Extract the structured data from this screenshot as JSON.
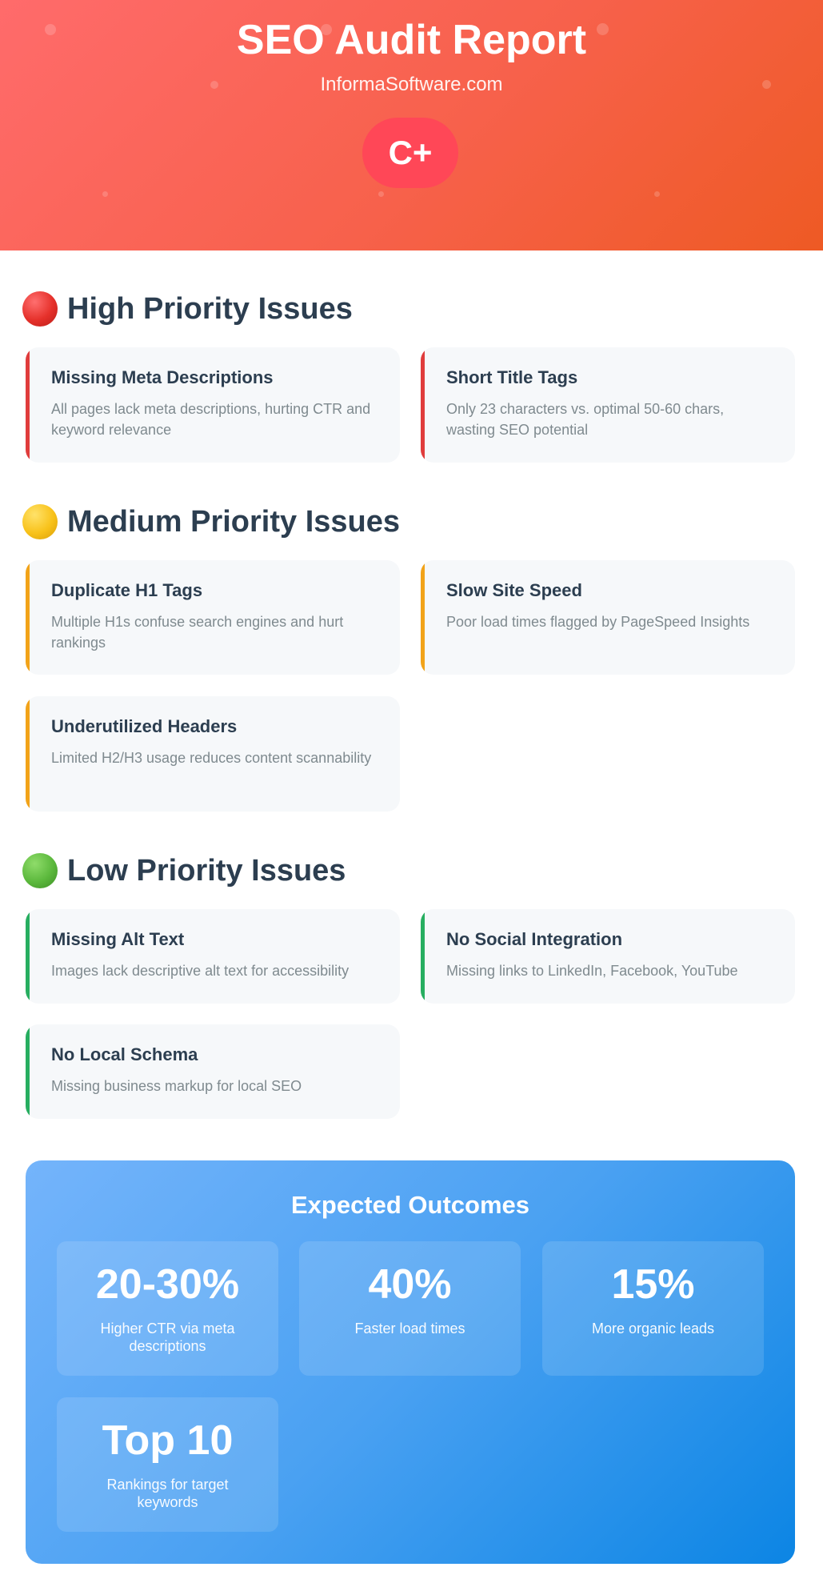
{
  "header": {
    "title": "SEO Audit Report",
    "domain": "InformaSoftware.com",
    "grade": "C+"
  },
  "colors": {
    "header_gradient": [
      "#ff6b6b",
      "#ee5a24"
    ],
    "grade_badge": "#ff4757",
    "high": "#e03c3c",
    "medium": "#f2a319",
    "low": "#27ae60",
    "outcomes_gradient": [
      "#74b4fb",
      "#0c85e4"
    ]
  },
  "sections": [
    {
      "icon": "red-circle-icon",
      "title": "High Priority Issues",
      "issues": [
        {
          "title": "Missing Meta Descriptions",
          "description": "All pages lack meta descriptions, hurting CTR and keyword relevance"
        },
        {
          "title": "Short Title Tags",
          "description": "Only 23 characters vs. optimal 50-60 chars, wasting SEO potential"
        }
      ]
    },
    {
      "icon": "yellow-circle-icon",
      "title": "Medium Priority Issues",
      "issues": [
        {
          "title": "Duplicate H1 Tags",
          "description": "Multiple H1s confuse search engines and hurt rankings"
        },
        {
          "title": "Slow Site Speed",
          "description": "Poor load times flagged by PageSpeed Insights"
        },
        {
          "title": "Underutilized Headers",
          "description": "Limited H2/H3 usage reduces content scannability"
        }
      ]
    },
    {
      "icon": "green-circle-icon",
      "title": "Low Priority Issues",
      "issues": [
        {
          "title": "Missing Alt Text",
          "description": "Images lack descriptive alt text for accessibility"
        },
        {
          "title": "No Social Integration",
          "description": "Missing links to LinkedIn, Facebook, YouTube"
        },
        {
          "title": "No Local Schema",
          "description": "Missing business markup for local SEO"
        }
      ]
    }
  ],
  "outcomes": {
    "title": "Expected Outcomes",
    "stats": [
      {
        "value": "20-30%",
        "label": "Higher CTR via meta descriptions"
      },
      {
        "value": "40%",
        "label": "Faster load times"
      },
      {
        "value": "15%",
        "label": "More organic leads"
      },
      {
        "value": "Top 10",
        "label": "Rankings for target keywords"
      }
    ]
  }
}
